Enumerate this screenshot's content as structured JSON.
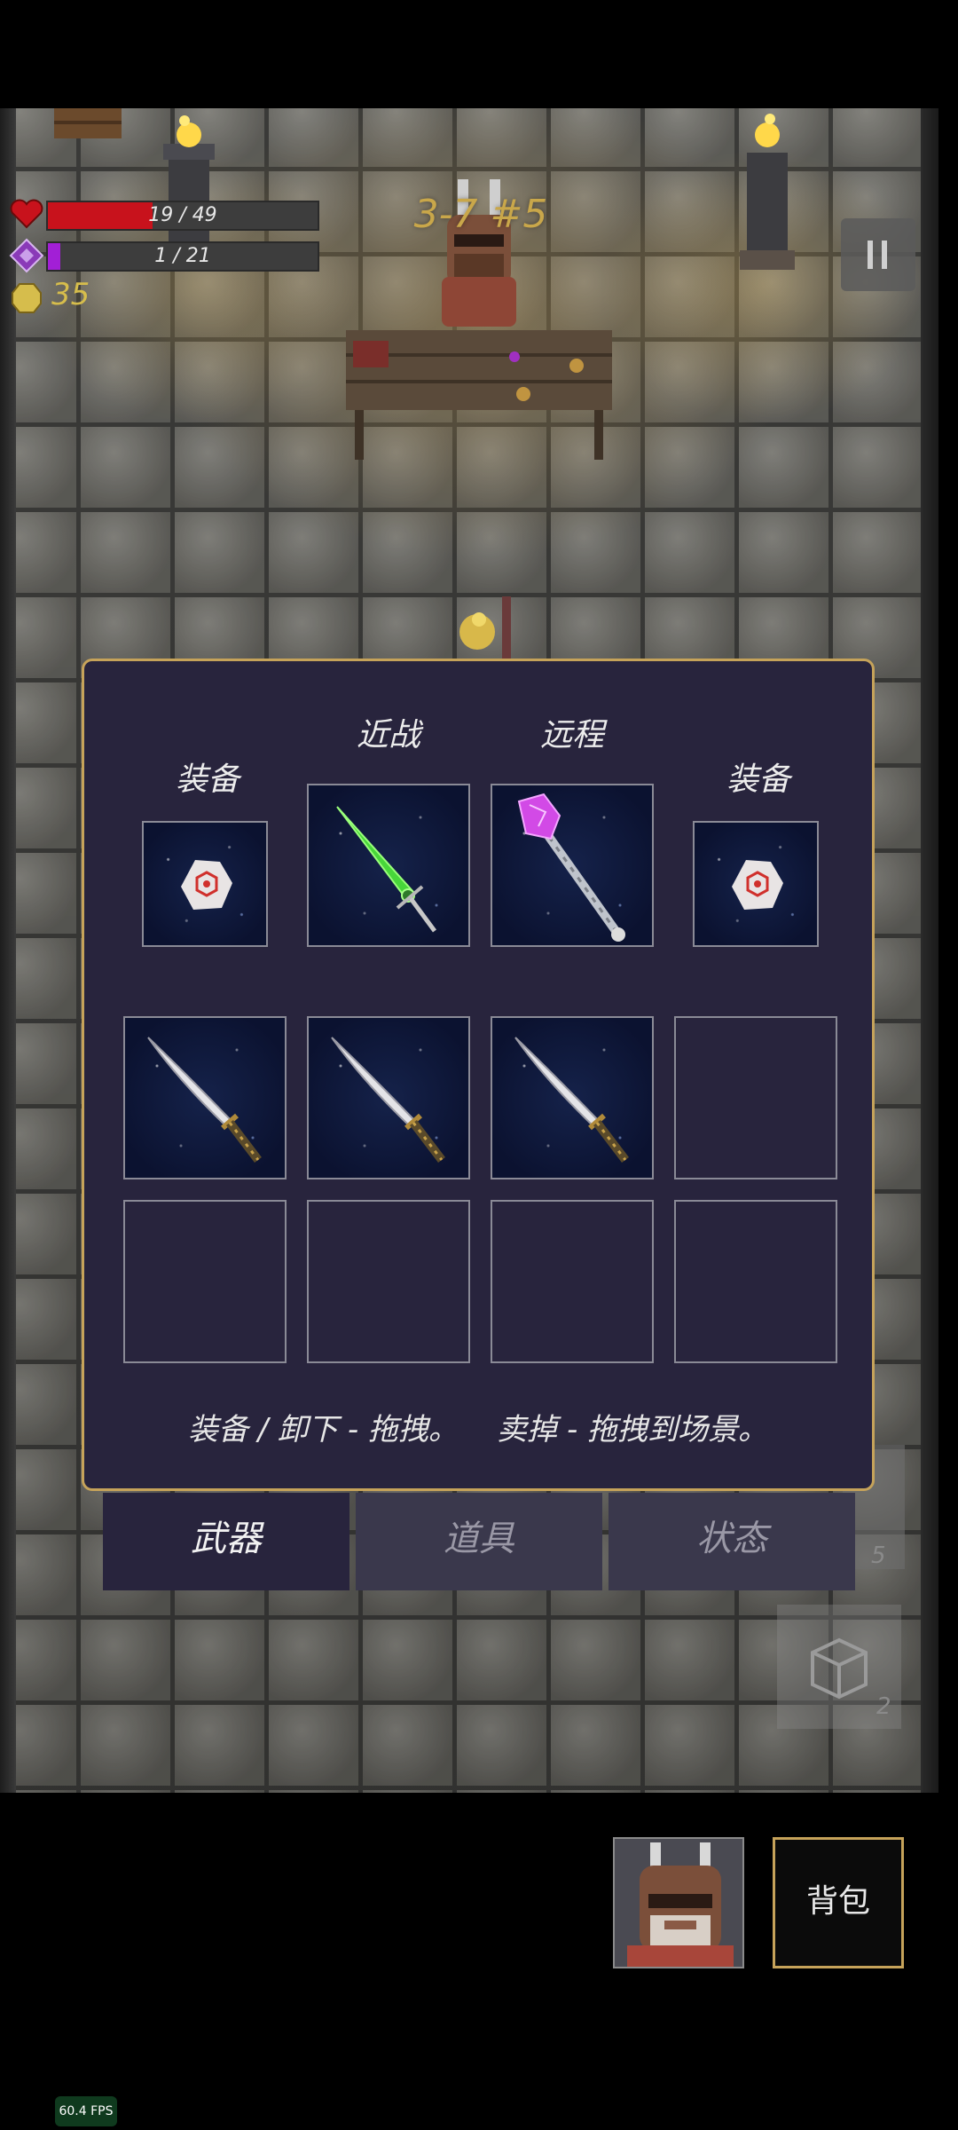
{
  "hud": {
    "hp": {
      "current": 19,
      "max": 49,
      "text": "19 / 49",
      "icon": "heart-icon",
      "color": "#c8121c"
    },
    "mana": {
      "current": 1,
      "max": 21,
      "text": "1 / 21",
      "icon": "diamond-icon",
      "color": "#a21fd6"
    },
    "coins": {
      "value": "35",
      "icon": "coin-icon"
    },
    "stage": "3-7 #5",
    "pause_icon": "pause-icon"
  },
  "inventory": {
    "labels": {
      "melee": "近战",
      "ranged": "远程",
      "equip_left": "装备",
      "equip_right": "装备"
    },
    "equipped": {
      "left_accessory": "gear-shard-icon",
      "melee_weapon": "green-sword-icon",
      "ranged_weapon": "crystal-staff-icon",
      "right_accessory": "gear-shard-icon"
    },
    "bag_slots": [
      "katana-icon",
      "katana-icon",
      "katana-icon",
      "",
      "",
      "",
      "",
      ""
    ],
    "hint": "装备 / 卸下 - 拖拽。    卖掉 - 拖拽到场景。"
  },
  "tabs": [
    {
      "label": "武器",
      "active": true
    },
    {
      "label": "道具",
      "active": false
    },
    {
      "label": "状态",
      "active": false
    }
  ],
  "side_counters": {
    "top": "5",
    "bottom": "2"
  },
  "bottom": {
    "backpack_label": "背包",
    "portrait_icon": "character-portrait-icon"
  },
  "fps": "60.4 FPS",
  "colors": {
    "panel_bg": "#28243d",
    "panel_border": "#c6a35a",
    "gold": "#c9a74a"
  }
}
